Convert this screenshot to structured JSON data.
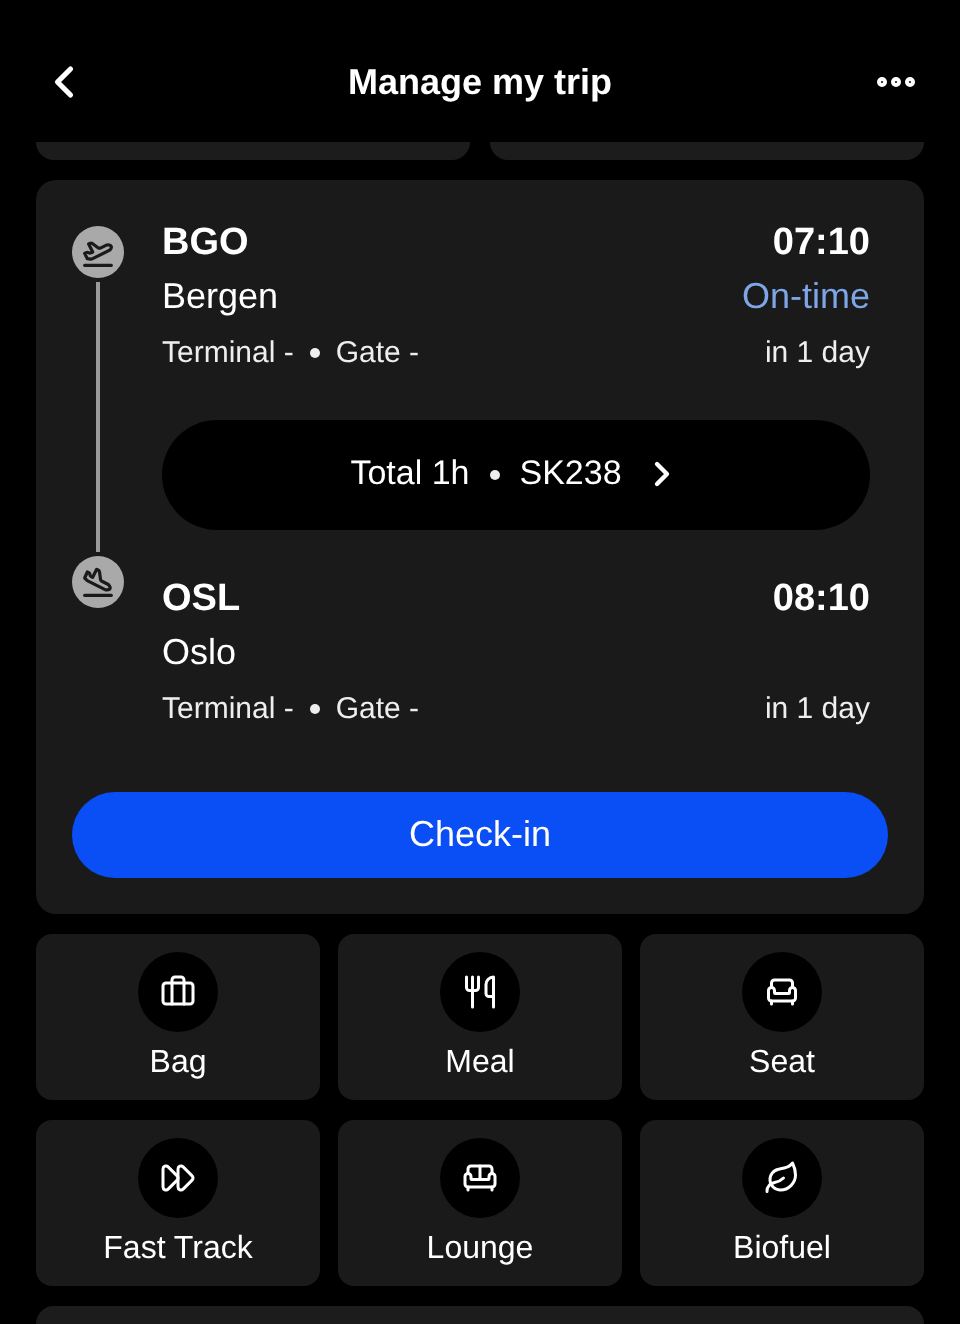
{
  "header": {
    "title": "Manage my trip"
  },
  "flight": {
    "segments": [
      {
        "kind": "departure",
        "code": "BGO",
        "city": "Bergen",
        "terminal": "Terminal -",
        "gate": "Gate -",
        "time": "07:10",
        "status": "On-time",
        "day": "in 1 day"
      },
      {
        "kind": "arrival",
        "code": "OSL",
        "city": "Oslo",
        "terminal": "Terminal -",
        "gate": "Gate -",
        "time": "08:10",
        "day": "in 1 day"
      }
    ],
    "summary": {
      "duration": "Total 1h",
      "flight_number": "SK238"
    },
    "action": "Check-in"
  },
  "services": [
    {
      "kind": "bag",
      "label": "Bag"
    },
    {
      "kind": "meal",
      "label": "Meal"
    },
    {
      "kind": "seat",
      "label": "Seat"
    },
    {
      "kind": "fast_track",
      "label": "Fast Track"
    },
    {
      "kind": "lounge",
      "label": "Lounge"
    },
    {
      "kind": "biofuel",
      "label": "Biofuel"
    }
  ]
}
